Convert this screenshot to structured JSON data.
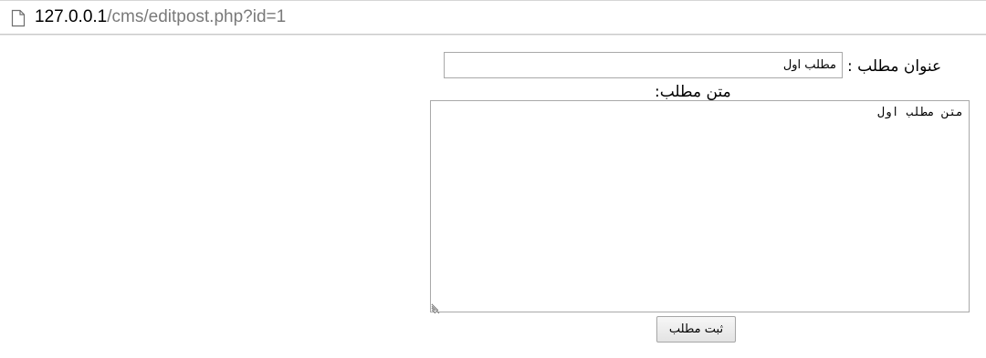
{
  "address_bar": {
    "url_host": "127.0.0.1",
    "url_path": "/cms/editpost.php?id=1",
    "icon": "page-icon"
  },
  "form": {
    "title_label": "عنوان مطلب :",
    "title_value": "مطلب اول",
    "body_label": "متن مطلب:",
    "body_value": "متن مطلب اول",
    "submit_label": "ثبت مطلب"
  }
}
